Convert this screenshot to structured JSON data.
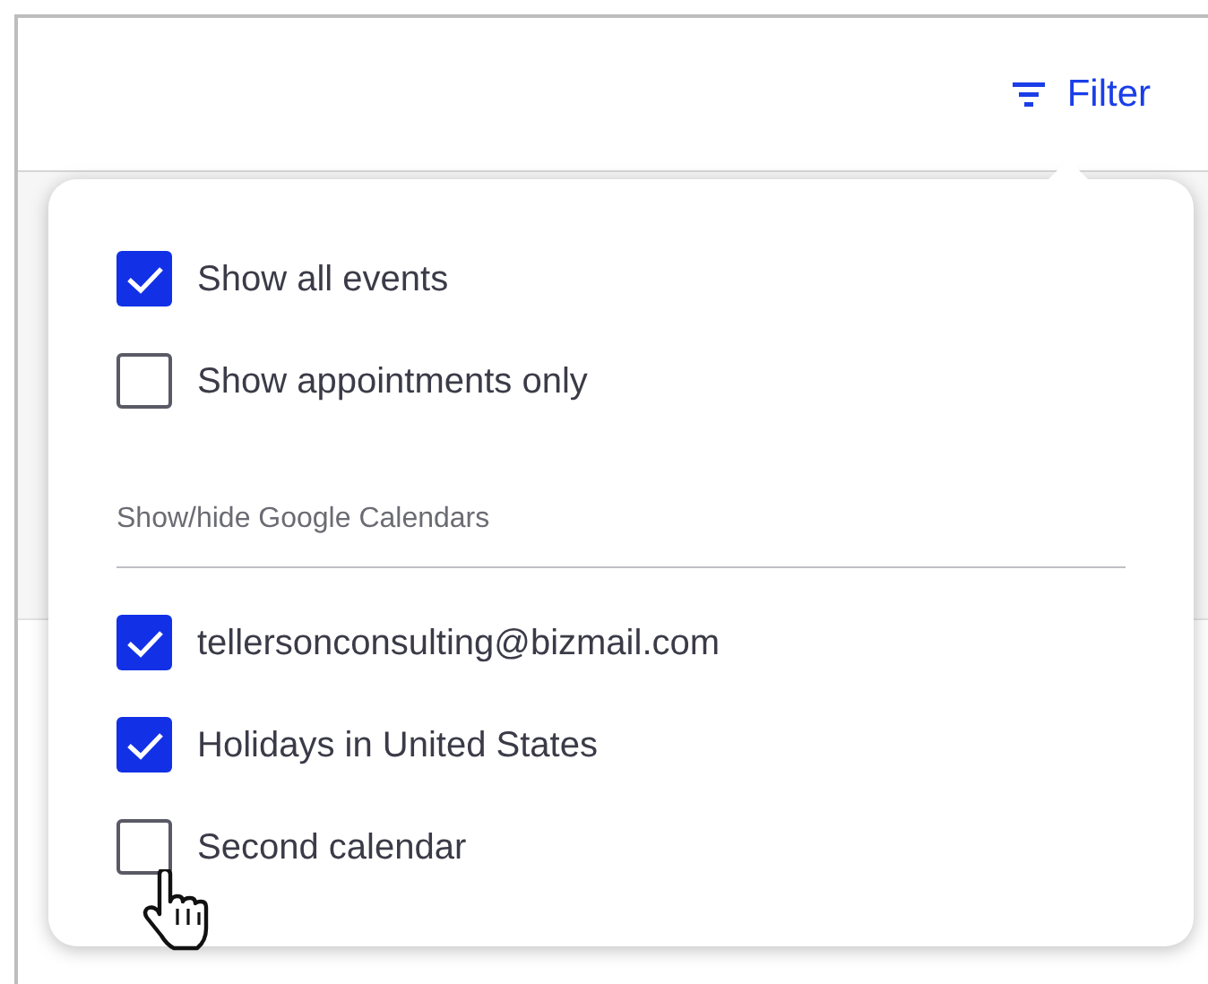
{
  "filter_button": {
    "label": "Filter"
  },
  "filter_menu": {
    "options": [
      {
        "label": "Show all events",
        "checked": true
      },
      {
        "label": "Show appointments only",
        "checked": false
      }
    ],
    "calendars_heading": "Show/hide Google Calendars",
    "calendars": [
      {
        "label": "tellersonconsulting@bizmail.com",
        "checked": true
      },
      {
        "label": "Holidays in United States",
        "checked": true
      },
      {
        "label": "Second calendar",
        "checked": false
      }
    ]
  }
}
